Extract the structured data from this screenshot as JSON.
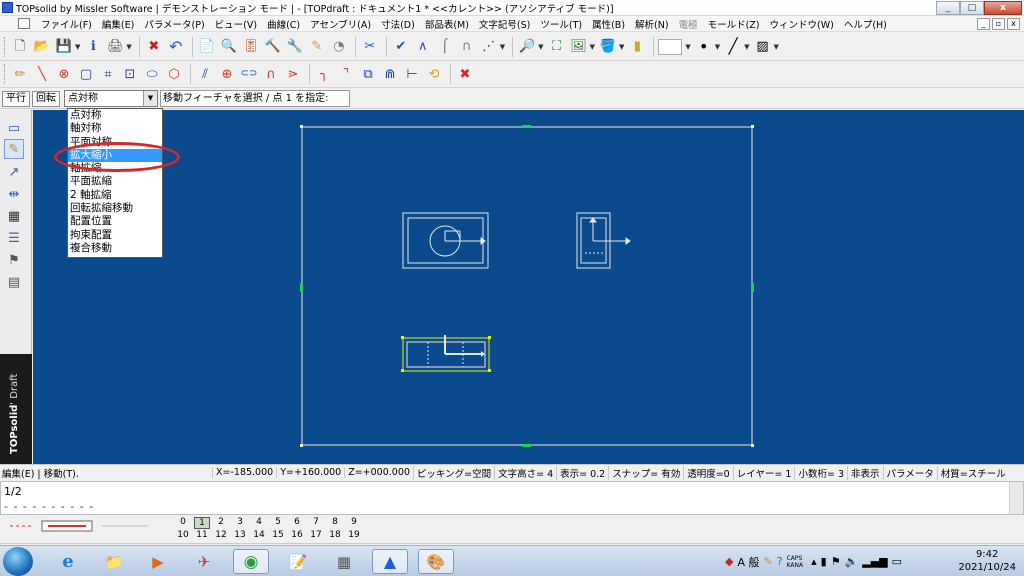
{
  "window": {
    "title": "TOPsolid by Missler Software | デモンストレーション モード | - [TOPdraft : ドキュメント1 *  <<カレント>> (アソシアティブ モード)]",
    "buttons": [
      "_",
      "□",
      "x"
    ]
  },
  "menu": {
    "items": [
      "ファイル(F)",
      "編集(E)",
      "パラメータ(P)",
      "ビュー(V)",
      "曲線(C)",
      "アセンブリ(A)",
      "寸法(D)",
      "部品表(M)",
      "文字記号(S)",
      "ツール(T)",
      "属性(B)",
      "解析(N)",
      "電極",
      "モールド(Z)",
      "ウィンドウ(W)",
      "ヘルプ(H)"
    ],
    "disabled_item": "電極",
    "mdi_buttons": [
      "_",
      "▫",
      "x"
    ]
  },
  "toolbar1": {
    "icons": [
      {
        "name": "new-document-icon",
        "glyph": "🗋"
      },
      {
        "name": "open-folder-icon",
        "glyph": "📂"
      },
      {
        "name": "save-icon",
        "glyph": "💾"
      },
      {
        "name": "properties-icon",
        "glyph": "ℹ"
      },
      {
        "name": "print-icon",
        "glyph": "🖨"
      },
      {
        "name": "delete-x-icon",
        "glyph": "✖"
      },
      {
        "name": "undo-icon",
        "glyph": "↶"
      },
      {
        "name": "document-properties-icon",
        "glyph": "📄"
      },
      {
        "name": "search-elements-icon",
        "glyph": "🔍"
      },
      {
        "name": "equalizer-icon",
        "glyph": "🎚"
      },
      {
        "name": "hammer-icon",
        "glyph": "🔨"
      },
      {
        "name": "tools-icon",
        "glyph": "🔧"
      },
      {
        "name": "pen-edit-icon",
        "glyph": "✎"
      },
      {
        "name": "measure-icon",
        "glyph": "◔"
      },
      {
        "name": "scissors-icon",
        "glyph": "✂"
      },
      {
        "name": "check-icon",
        "glyph": "✔"
      },
      {
        "name": "compass-icon",
        "glyph": "∧"
      },
      {
        "name": "hook-icon",
        "glyph": "⌠"
      },
      {
        "name": "magnet-icon",
        "glyph": "∩"
      },
      {
        "name": "grid-snap-icon",
        "glyph": "⋰"
      },
      {
        "name": "zoom-icon",
        "glyph": "🔎"
      },
      {
        "name": "zoom-fit-icon",
        "glyph": "⛶"
      },
      {
        "name": "view-image-icon",
        "glyph": "🖼"
      },
      {
        "name": "paint-bucket-icon",
        "glyph": "🪣"
      },
      {
        "name": "battery-icon",
        "glyph": "▮"
      }
    ]
  },
  "toolbar2": {
    "icons": [
      {
        "name": "pencil-icon",
        "glyph": "✏"
      },
      {
        "name": "line-tool-icon",
        "glyph": "╲"
      },
      {
        "name": "circle-point-icon",
        "glyph": "⊗"
      },
      {
        "name": "rectangle-icon",
        "glyph": "▢"
      },
      {
        "name": "trim-icon",
        "glyph": "⌗"
      },
      {
        "name": "dimension-icon",
        "glyph": "⊡"
      },
      {
        "name": "ellipse-icon",
        "glyph": "⬭"
      },
      {
        "name": "polygon-icon",
        "glyph": "⬡"
      },
      {
        "name": "parallel-lines-icon",
        "glyph": "⫽"
      },
      {
        "name": "crosshair-icon",
        "glyph": "⊕"
      },
      {
        "name": "slot-icon",
        "glyph": "⊂⊃"
      },
      {
        "name": "arc-icon",
        "glyph": "∩"
      },
      {
        "name": "angle-icon",
        "glyph": "⋗"
      },
      {
        "name": "corner-fillet-icon",
        "glyph": "╮"
      },
      {
        "name": "chamfer-icon",
        "glyph": "⌝"
      },
      {
        "name": "offset-icon",
        "glyph": "⧉"
      },
      {
        "name": "arch-icon",
        "glyph": "⋒"
      },
      {
        "name": "extend-icon",
        "glyph": "⊢"
      },
      {
        "name": "tangent-icon",
        "glyph": "⟲"
      },
      {
        "name": "red-cancel-icon",
        "glyph": "✖"
      }
    ]
  },
  "commandbar": {
    "translate_label": "平行",
    "rotate_label": "回転",
    "transform_value": "点対称",
    "prompt": "移動フィーチャを選択 / 点 1 を指定:"
  },
  "dropdown": {
    "options": [
      "点対称",
      "軸対称",
      "平面対称",
      "拡大縮小",
      "軸拡縮",
      "平面拡縮",
      "2 軸拡縮",
      "回転拡縮移動",
      "配置位置",
      "拘束配置",
      "複合移動"
    ],
    "highlighted": "拡大縮小"
  },
  "leftbar": {
    "icons": [
      {
        "name": "window-icon",
        "glyph": "▭"
      },
      {
        "name": "pen-icon",
        "glyph": "✎"
      },
      {
        "name": "arrow-icon",
        "glyph": "↗"
      },
      {
        "name": "dimension-tool-icon",
        "glyph": "⇹"
      },
      {
        "name": "table-grid-icon",
        "glyph": "▦"
      },
      {
        "name": "layers-stack-icon",
        "glyph": "☰"
      },
      {
        "name": "flag-icon",
        "glyph": "⚑"
      },
      {
        "name": "drive-icon",
        "glyph": "▤"
      }
    ],
    "brand": "TOPsolid",
    "brand_product": "' Draft"
  },
  "status": {
    "left": "編集(E) | 移動(T).",
    "cells": [
      "X=-185.000",
      "Y=+160.000",
      "Z=+000.000",
      "ピッキング=空間",
      "文字高さ=  4",
      "表示=   0.2",
      "スナップ= 有効",
      "透明度=0",
      "レイヤー=  1",
      "小数桁= 3",
      "非表示",
      "パラメータ",
      "材質=スチール"
    ]
  },
  "cmdwindow": {
    "line1": "1/2",
    "line2": "- - - - - - - - - -"
  },
  "layers": {
    "row1": [
      "0",
      "1",
      "2",
      "3",
      "4",
      "5",
      "6",
      "7",
      "8",
      "9"
    ],
    "row2": [
      "10",
      "11",
      "12",
      "13",
      "14",
      "15",
      "16",
      "17",
      "18",
      "19"
    ],
    "current": "1"
  },
  "taskbar": {
    "icons": [
      {
        "name": "ie-browser-icon",
        "glyph": "e"
      },
      {
        "name": "file-explorer-icon",
        "glyph": "📁"
      },
      {
        "name": "media-player-icon",
        "glyph": "▶"
      },
      {
        "name": "network-app-icon",
        "glyph": "✈"
      },
      {
        "name": "chrome-icon",
        "glyph": "◉"
      },
      {
        "name": "notepad-icon",
        "glyph": "📝"
      },
      {
        "name": "calculator-icon",
        "glyph": "▦"
      },
      {
        "name": "topsolid-app-icon",
        "glyph": "▲"
      },
      {
        "name": "paint-app-icon",
        "glyph": "🎨"
      }
    ],
    "ime": "A 般",
    "caps": "CAPS",
    "kana": "KANA",
    "time": "9:42",
    "date": "2021/10/24"
  },
  "colors": {
    "canvas": "#0b4a8c",
    "sheet_border": "#e6e6e6",
    "handle": "#1fd24a",
    "selection": "#e7f000",
    "highlight": "#3399ff",
    "annotation": "#d8262e"
  }
}
